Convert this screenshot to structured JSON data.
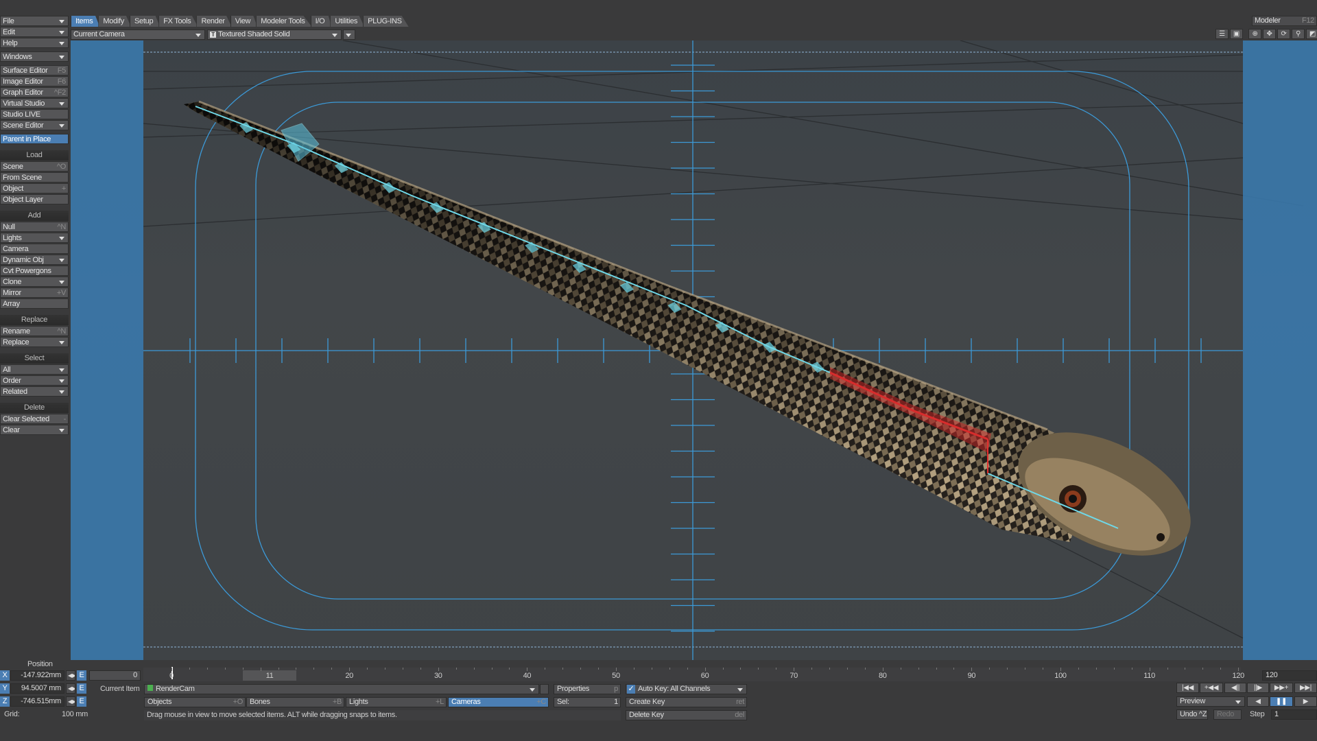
{
  "menu": {
    "groups": [
      {
        "items": [
          {
            "label": "File",
            "dd": true
          },
          {
            "label": "Edit",
            "dd": true
          },
          {
            "label": "Help",
            "dd": true
          }
        ]
      },
      {
        "items": [
          {
            "label": "Windows",
            "dd": true
          }
        ]
      },
      {
        "items": [
          {
            "label": "Surface Editor",
            "sc": "F5"
          },
          {
            "label": "Image Editor",
            "sc": "F6"
          },
          {
            "label": "Graph Editor",
            "sc": "^F2"
          },
          {
            "label": "Virtual Studio",
            "dd": true
          },
          {
            "label": "Studio LIVE"
          },
          {
            "label": "Scene Editor",
            "dd": true
          }
        ]
      },
      {
        "items": [
          {
            "label": "Parent in Place",
            "active": true
          }
        ]
      },
      {
        "header": "Load",
        "items": [
          {
            "label": "Scene",
            "sc": "^O"
          },
          {
            "label": "From Scene"
          },
          {
            "label": "Object",
            "sc": "+"
          },
          {
            "label": "Object Layer"
          }
        ]
      },
      {
        "header": "Add",
        "items": [
          {
            "label": "Null",
            "sc": "^N"
          },
          {
            "label": "Lights",
            "dd": true
          },
          {
            "label": "Camera"
          },
          {
            "label": "Dynamic Obj",
            "dd": true
          },
          {
            "label": "Cvt Powergons"
          },
          {
            "label": "Clone",
            "dd": true
          },
          {
            "label": "Mirror",
            "sc": "+V"
          },
          {
            "label": "Array"
          }
        ]
      },
      {
        "header": "Replace",
        "items": [
          {
            "label": "Rename",
            "sc": "^N"
          },
          {
            "label": "Replace",
            "dd": true
          }
        ]
      },
      {
        "header": "Select",
        "items": [
          {
            "label": "All",
            "dd": true
          },
          {
            "label": "Order",
            "dd": true
          },
          {
            "label": "Related",
            "dd": true
          }
        ]
      },
      {
        "header": "Delete",
        "items": [
          {
            "label": "Clear Selected",
            "sc": "-"
          },
          {
            "label": "Clear",
            "dd": true
          }
        ]
      }
    ]
  },
  "tabs": [
    "Items",
    "Modify",
    "Setup",
    "FX Tools",
    "Render",
    "View",
    "Modeler Tools",
    "I/O",
    "Utilities",
    "PLUG-INS"
  ],
  "active_tab": "Items",
  "viewport": {
    "view": "Current Camera",
    "render_mode": "Textured Shaded Solid",
    "render_mode_icon": "T"
  },
  "modeler": {
    "label": "Modeler",
    "shortcut": "F12"
  },
  "view_icons": [
    "list-icon",
    "save-view-icon",
    "move-view-icon",
    "pan-icon",
    "rotate-view-icon",
    "zoom-icon",
    "maximize-icon"
  ],
  "position": {
    "label": "Position",
    "x": "-147.922mm",
    "y": "94.5007 mm",
    "z": "-746.515mm",
    "grid_label": "Grid:",
    "grid": "100 mm",
    "axes": [
      "X",
      "Y",
      "Z"
    ],
    "env": "E"
  },
  "timeline": {
    "start": "0",
    "current": "11",
    "end": "120",
    "end_field": "120",
    "ticks": [
      "0",
      "20",
      "30",
      "40",
      "50",
      "60",
      "70",
      "80",
      "90",
      "100",
      "110",
      "120"
    ]
  },
  "current_item": {
    "label": "Current Item",
    "value": "RenderCam"
  },
  "properties": {
    "label": "Properties",
    "sc": "p"
  },
  "autokey": {
    "label": "Auto Key: All Channels",
    "checked": true
  },
  "filters": [
    {
      "label": "Objects",
      "sc": "+O"
    },
    {
      "label": "Bones",
      "sc": "+B"
    },
    {
      "label": "Lights",
      "sc": "+L"
    },
    {
      "label": "Cameras",
      "sc": "+C",
      "active": true
    }
  ],
  "sel": {
    "label": "Sel:",
    "value": "1"
  },
  "keys": {
    "create": "Create Key",
    "create_sc": "ret",
    "delete": "Delete Key",
    "delete_sc": "del"
  },
  "status": "Drag mouse in view to move selected items. ALT while dragging snaps to items.",
  "transport": {
    "preview": "Preview",
    "undo": "Undo ^Z",
    "redo": "Redo",
    "step_label": "Step",
    "step": "1"
  },
  "colors": {
    "accent": "#4b7eb3",
    "bone": "#6fd8e8",
    "bone_selected": "#e03030",
    "safe_area": "#3c9ad8"
  }
}
